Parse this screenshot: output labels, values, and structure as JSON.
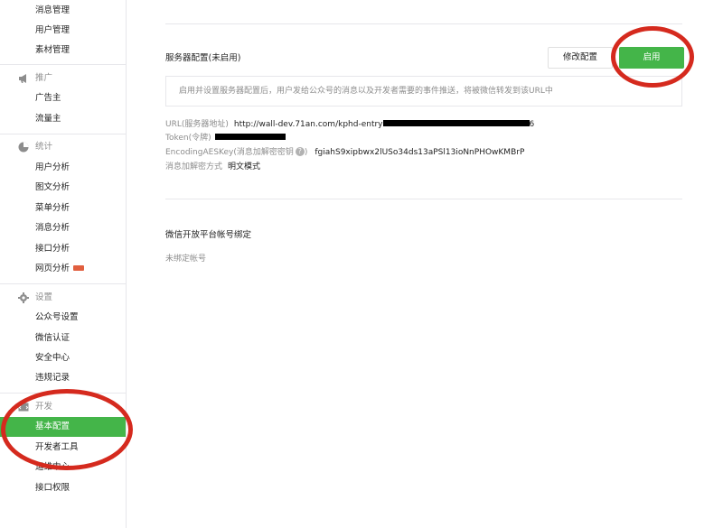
{
  "sidebar": {
    "top_items": [
      {
        "label": "消息管理"
      },
      {
        "label": "用户管理"
      },
      {
        "label": "素材管理"
      }
    ],
    "groups": [
      {
        "title": "推广",
        "icon": "megaphone-icon",
        "items": [
          {
            "label": "广告主"
          },
          {
            "label": "流量主"
          }
        ]
      },
      {
        "title": "统计",
        "icon": "pie-chart-icon",
        "items": [
          {
            "label": "用户分析"
          },
          {
            "label": "图文分析"
          },
          {
            "label": "菜单分析"
          },
          {
            "label": "消息分析"
          },
          {
            "label": "接口分析"
          },
          {
            "label": "网页分析",
            "badge": "new"
          }
        ]
      },
      {
        "title": "设置",
        "icon": "gear-icon",
        "items": [
          {
            "label": "公众号设置"
          },
          {
            "label": "微信认证"
          },
          {
            "label": "安全中心"
          },
          {
            "label": "违规记录"
          }
        ]
      },
      {
        "title": "开发",
        "icon": "developer-icon",
        "items": [
          {
            "label": "基本配置",
            "active": true
          },
          {
            "label": "开发者工具"
          },
          {
            "label": "运维中心"
          },
          {
            "label": "接口权限"
          }
        ]
      }
    ]
  },
  "server_config": {
    "title": "服务器配置(未启用)",
    "modify_button": "修改配置",
    "enable_button": "启用",
    "tip": "启用并设置服务器配置后，用户发给公众号的消息以及开发者需要的事件推送，将被微信转发到该URL中",
    "url_label": "URL(服务器地址)",
    "url_value": "http://wall-dev.71an.com/kphd-entry",
    "url_tail": "6",
    "token_label": "Token(令牌)",
    "aes_key_label": "EncodingAESKey(消息加解密密钥",
    "aes_key_label_close": ")",
    "aes_key_value": "fgiahS9xipbwx2lUSo34ds13aPSl13ioNnPHOwKMBrP",
    "encrypt_mode_label": "消息加解密方式",
    "encrypt_mode_value": "明文模式"
  },
  "open_platform": {
    "title": "微信开放平台帐号绑定",
    "status": "未绑定帐号"
  },
  "colors": {
    "accent": "#44b549",
    "annotation_ring": "#d52a1e"
  }
}
